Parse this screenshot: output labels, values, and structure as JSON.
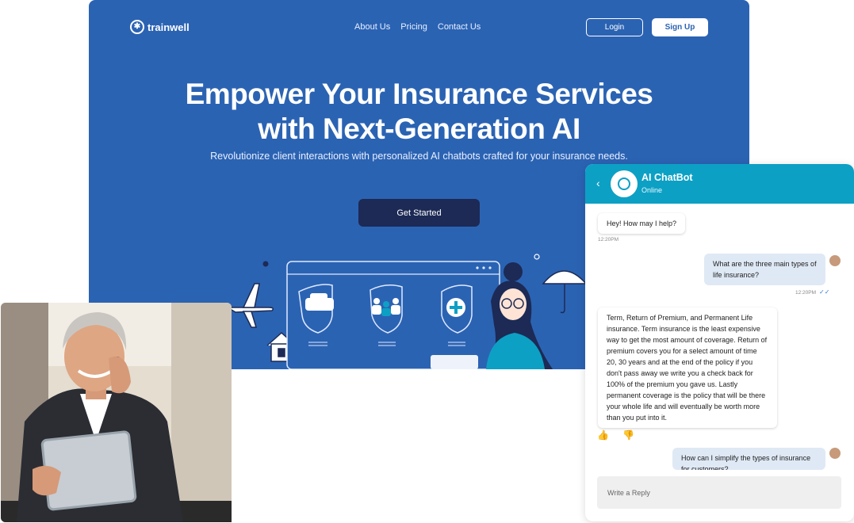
{
  "nav": {
    "logo_text": "trainwell",
    "links": [
      "About Us",
      "Pricing",
      "Contact Us"
    ],
    "login_label": "Login",
    "signup_label": "Sign Up"
  },
  "hero": {
    "title_line1": "Empower Your Insurance Services",
    "title_line2": "with Next-Generation AI",
    "subtitle": "Revolutionize client interactions with personalized AI chatbots crafted for your insurance needs.",
    "cta_label": "Get Started"
  },
  "chat": {
    "name": "AI ChatBot",
    "status": "Online",
    "messages": [
      {
        "from": "bot",
        "text": "Hey! How may I help?",
        "time": "12:20PM"
      },
      {
        "from": "user",
        "text": "What are the three main types of life insurance?",
        "time": "12:20PM"
      },
      {
        "from": "bot",
        "text": "Term, Return of Premium, and Permanent Life insurance. Term insurance is the least expensive way to get the most amount of coverage. Return of premium covers you for a select amount of time 20, 30 years and at the end of the policy if you don't pass away we write you a check back for 100% of the premium you gave us. Lastly permanent coverage is the policy that will be there your whole life and will eventually be worth more than you put into it."
      },
      {
        "from": "user",
        "text": "How can I simplify the types of insurance for customers?"
      }
    ],
    "reply_placeholder": "Write a Reply"
  },
  "colors": {
    "hero_bg": "#2b63b3",
    "cta_bg": "#1c2a55",
    "chat_header": "#0da0c5"
  }
}
